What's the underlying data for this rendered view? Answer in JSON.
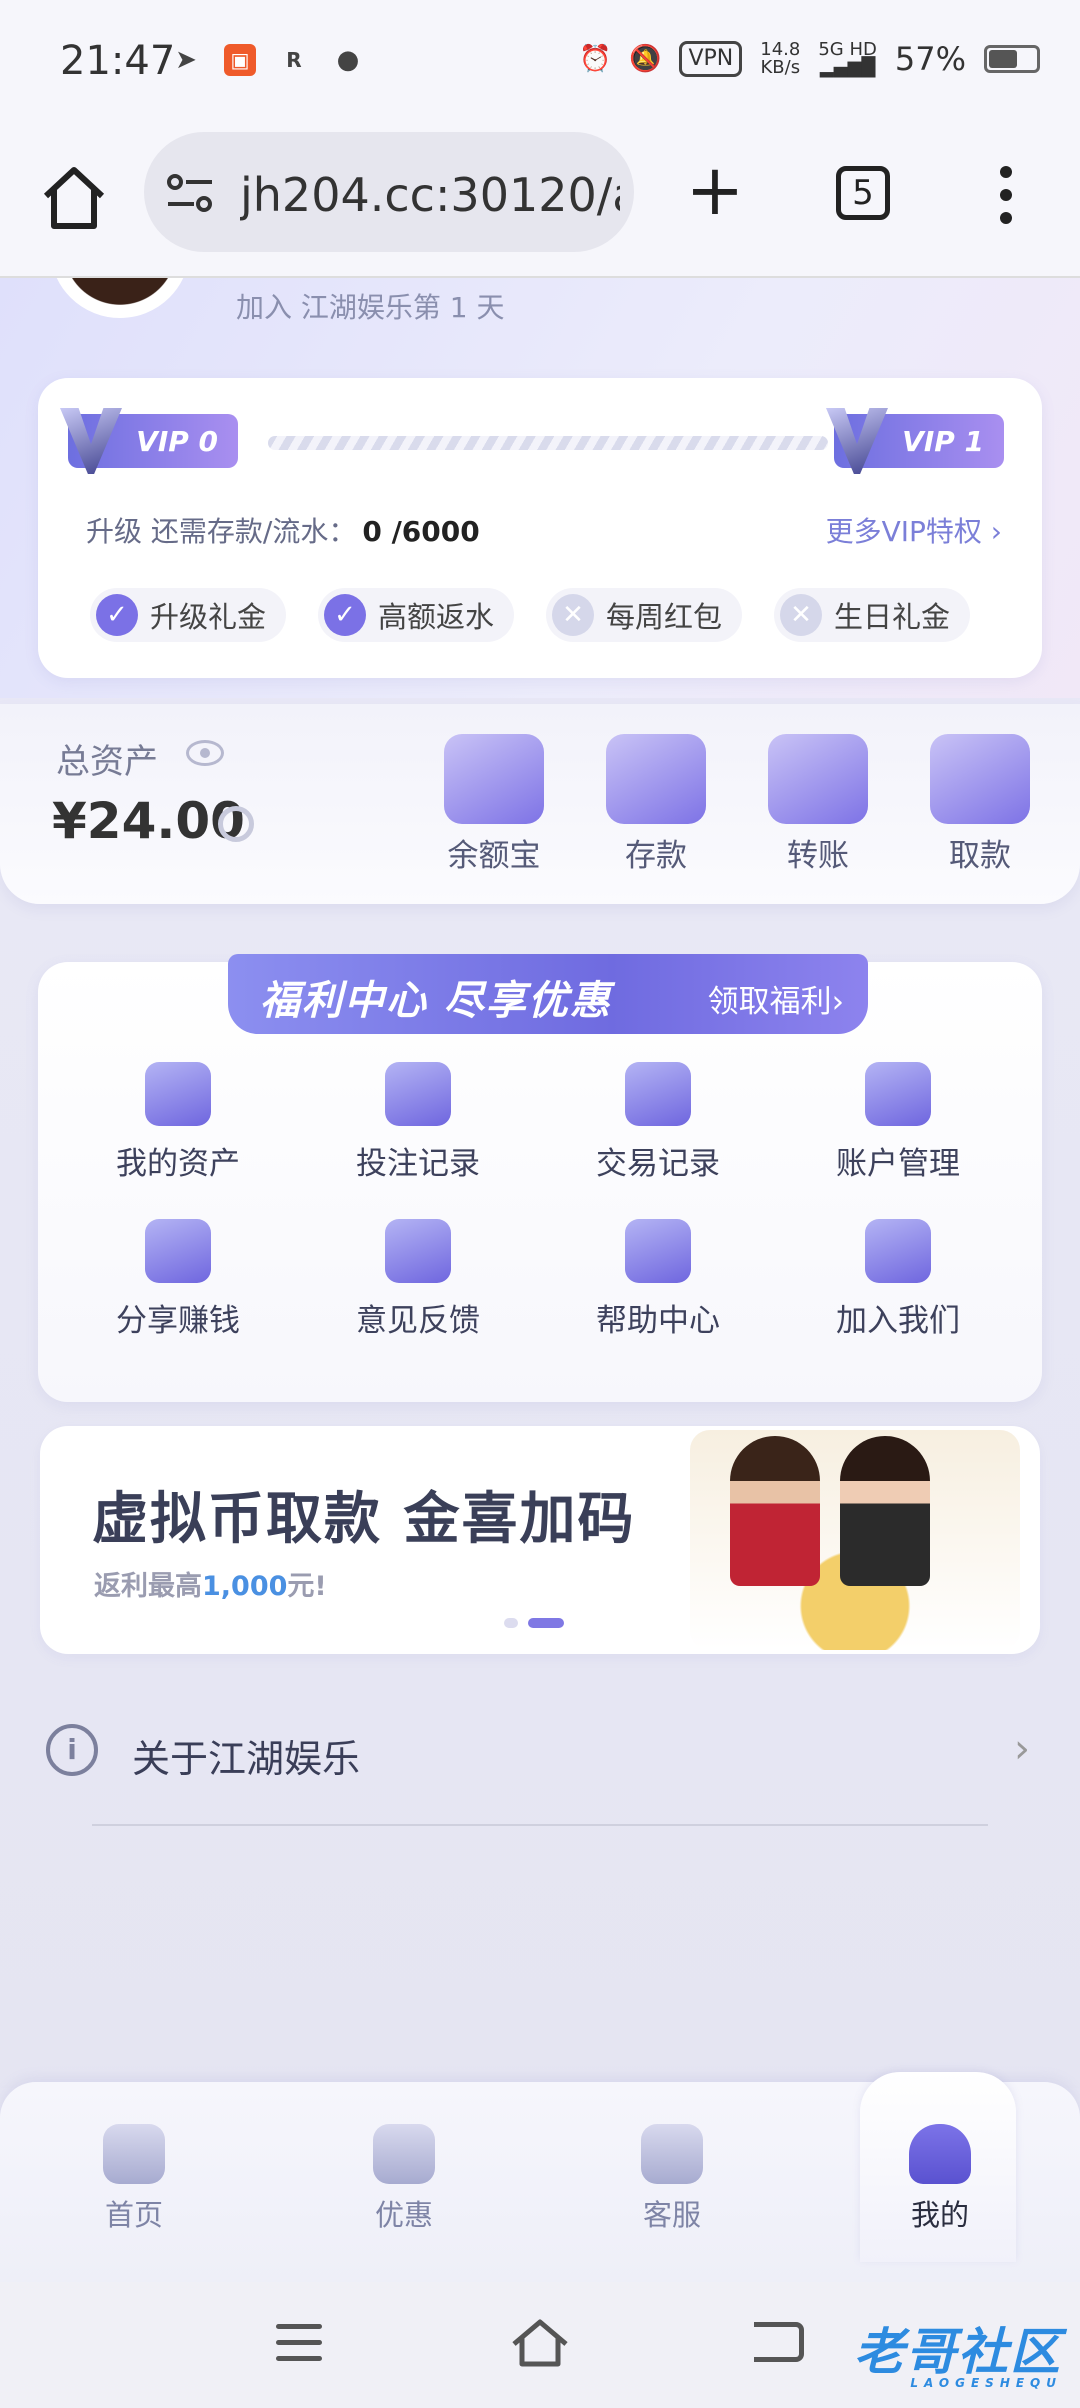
{
  "status_bar": {
    "time": "21:47",
    "vpn": "VPN",
    "speed_value": "14.8",
    "speed_unit": "KB/s",
    "network": "5G HD",
    "battery": "57%"
  },
  "browser": {
    "url": "jh204.cc:30120/a",
    "tab_count": "5"
  },
  "profile": {
    "join_text": "加入 江湖娱乐第 1 天"
  },
  "vip": {
    "current_level": "VIP 0",
    "next_level": "VIP 1",
    "upgrade_label": "升级 还需存款/流水：",
    "upgrade_value": "0 /6000",
    "more_link": "更多VIP特权 ›",
    "perks": [
      {
        "label": "升级礼金",
        "enabled": true
      },
      {
        "label": "高额返水",
        "enabled": true
      },
      {
        "label": "每周红包",
        "enabled": false
      },
      {
        "label": "生日礼金",
        "enabled": false
      }
    ]
  },
  "assets": {
    "label": "总资产",
    "value": "¥24.00",
    "actions": [
      {
        "label": "余额宝",
        "icon": "safe-icon"
      },
      {
        "label": "存款",
        "icon": "wallet-icon"
      },
      {
        "label": "转账",
        "icon": "transfer-icon"
      },
      {
        "label": "取款",
        "icon": "card-icon"
      }
    ]
  },
  "welfare": {
    "title": "福利中心 尽享优惠",
    "link": "领取福利›",
    "items": [
      {
        "label": "我的资产",
        "icon": "wallet-icon"
      },
      {
        "label": "投注记录",
        "icon": "clock-icon"
      },
      {
        "label": "交易记录",
        "icon": "exchange-icon"
      },
      {
        "label": "账户管理",
        "icon": "account-icon"
      },
      {
        "label": "分享赚钱",
        "icon": "yuan-icon"
      },
      {
        "label": "意见反馈",
        "icon": "feedback-icon"
      },
      {
        "label": "帮助中心",
        "icon": "help-icon"
      },
      {
        "label": "加入我们",
        "icon": "join-icon"
      }
    ]
  },
  "promo": {
    "title": "虚拟币取款 金喜加码",
    "sub_prefix": "返利最高",
    "sub_highlight": "1,000",
    "sub_suffix": "元!"
  },
  "about": {
    "label": "关于江湖娱乐"
  },
  "tabbar": {
    "tabs": [
      {
        "label": "首页",
        "icon": "home-icon"
      },
      {
        "label": "优惠",
        "icon": "discount-icon"
      },
      {
        "label": "客服",
        "icon": "headset-icon"
      },
      {
        "label": "我的",
        "icon": "user-icon",
        "active": true
      }
    ]
  },
  "watermark": {
    "text": "老哥社区",
    "sub": "LAOGESHEQU"
  },
  "colors": {
    "accent": "#7b71e6",
    "background": "#e6e6f3",
    "highlight_blue": "#4a90e2"
  }
}
